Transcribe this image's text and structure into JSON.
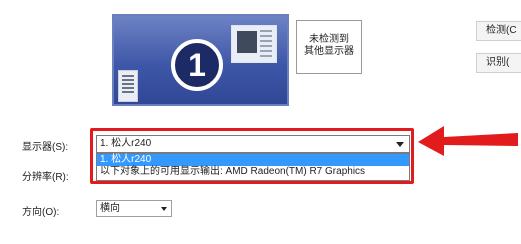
{
  "monitors": {
    "primary_number": "1",
    "secondary_line1": "未检测到",
    "secondary_line2": "其他显示器"
  },
  "buttons": {
    "detect": "检测(C",
    "identify": "识别("
  },
  "labels": {
    "display": "显示器(S):",
    "resolution": "分辨率(R):",
    "orientation": "方向(O):"
  },
  "display_dropdown": {
    "value": "1. 松人r240",
    "options": [
      "1. 松人r240",
      "以下对象上的可用显示输出: AMD Radeon(TM) R7 Graphics"
    ]
  },
  "orientation_dropdown": {
    "value": "横向"
  },
  "colors": {
    "highlight": "#e21c1c",
    "selection": "#3399ff",
    "monitor_blue": "#3f57a8"
  }
}
